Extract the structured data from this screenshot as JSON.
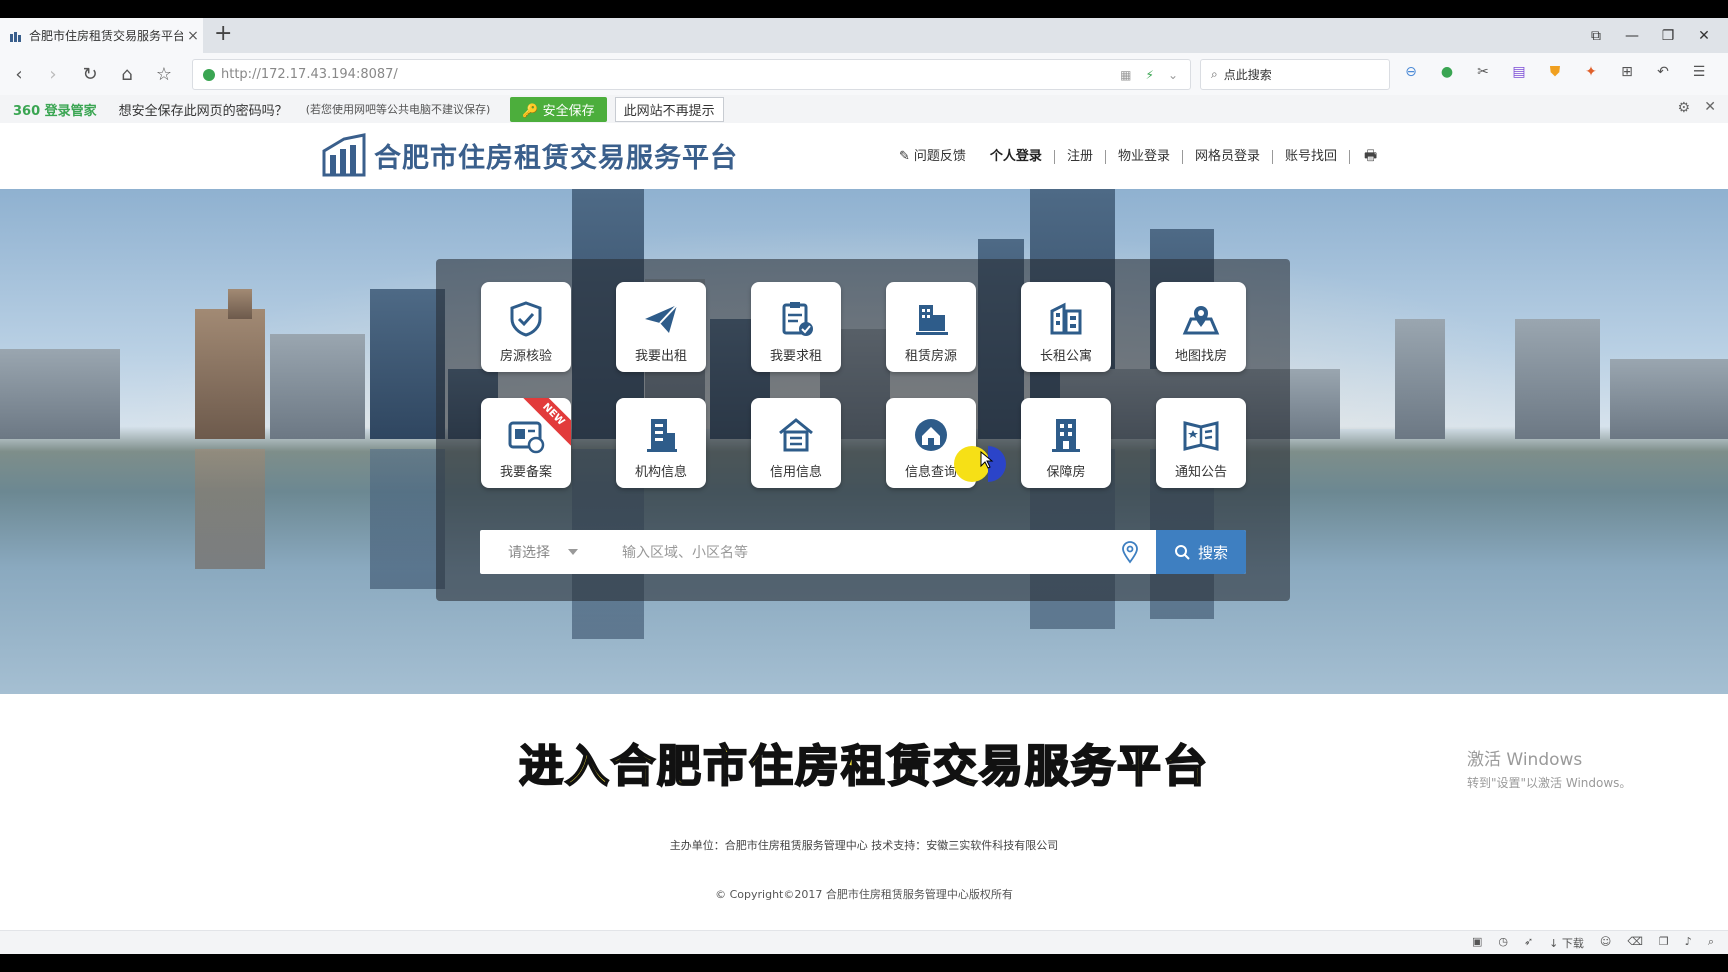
{
  "browser": {
    "tab_title": "合肥市住房租赁交易服务平台_",
    "tab_close": "×",
    "new_tab": "+",
    "address": {
      "host": "http://172.17.43.194",
      "port_path": ":8087/"
    },
    "search_placeholder": "点此搜索",
    "password_bar": {
      "brand": "360 登录管家",
      "question": "想安全保存此网页的密码吗？",
      "hint": "(若您使用网吧等公共电脑不建议保存)",
      "save_label": "安全保存",
      "never_label": "此网站不再提示"
    }
  },
  "site": {
    "logo_text": "合肥市住房租赁交易服务平台",
    "nav": {
      "feedback": "问题反馈",
      "personal_login": "个人登录",
      "register": "注册",
      "property_login": "物业登录",
      "grid_login": "网格员登录",
      "account_recovery": "账号找回"
    },
    "services": [
      {
        "label": "房源核验",
        "icon": "shield-check-icon"
      },
      {
        "label": "我要出租",
        "icon": "paper-plane-icon"
      },
      {
        "label": "我要求租",
        "icon": "clipboard-check-icon"
      },
      {
        "label": "租赁房源",
        "icon": "buildings-icon"
      },
      {
        "label": "长租公寓",
        "icon": "apartment-icon"
      },
      {
        "label": "地图找房",
        "icon": "map-pin-icon"
      },
      {
        "label": "我要备案",
        "icon": "record-icon",
        "badge": "NEW"
      },
      {
        "label": "机构信息",
        "icon": "office-building-icon"
      },
      {
        "label": "信用信息",
        "icon": "house-doc-icon"
      },
      {
        "label": "信息查询",
        "icon": "house-search-icon"
      },
      {
        "label": "保障房",
        "icon": "tower-icon"
      },
      {
        "label": "通知公告",
        "icon": "notice-book-icon"
      }
    ],
    "search": {
      "select_placeholder": "请选择",
      "keyword_placeholder": "输入区域、小区名等",
      "button_label": "搜索"
    },
    "footer": {
      "org": "主办单位：合肥市住房租赁服务管理中心   技术支持：安徽三实软件科技有限公司",
      "copyright": "© Copyright©2017 合肥市住房租赁服务管理中心版权所有"
    }
  },
  "overlay": {
    "subtitle": "进入合肥市住房租赁交易服务平台",
    "watermark_line1": "激活 Windows",
    "watermark_line2": "转到\"设置\"以激活 Windows。"
  },
  "statusbar": {
    "download_label": "下载"
  },
  "colors": {
    "brand_blue": "#3a5f8c",
    "search_button": "#3e7fc1",
    "save_green": "#4cae3c",
    "subtitle_yellow": "#f7e53b"
  }
}
